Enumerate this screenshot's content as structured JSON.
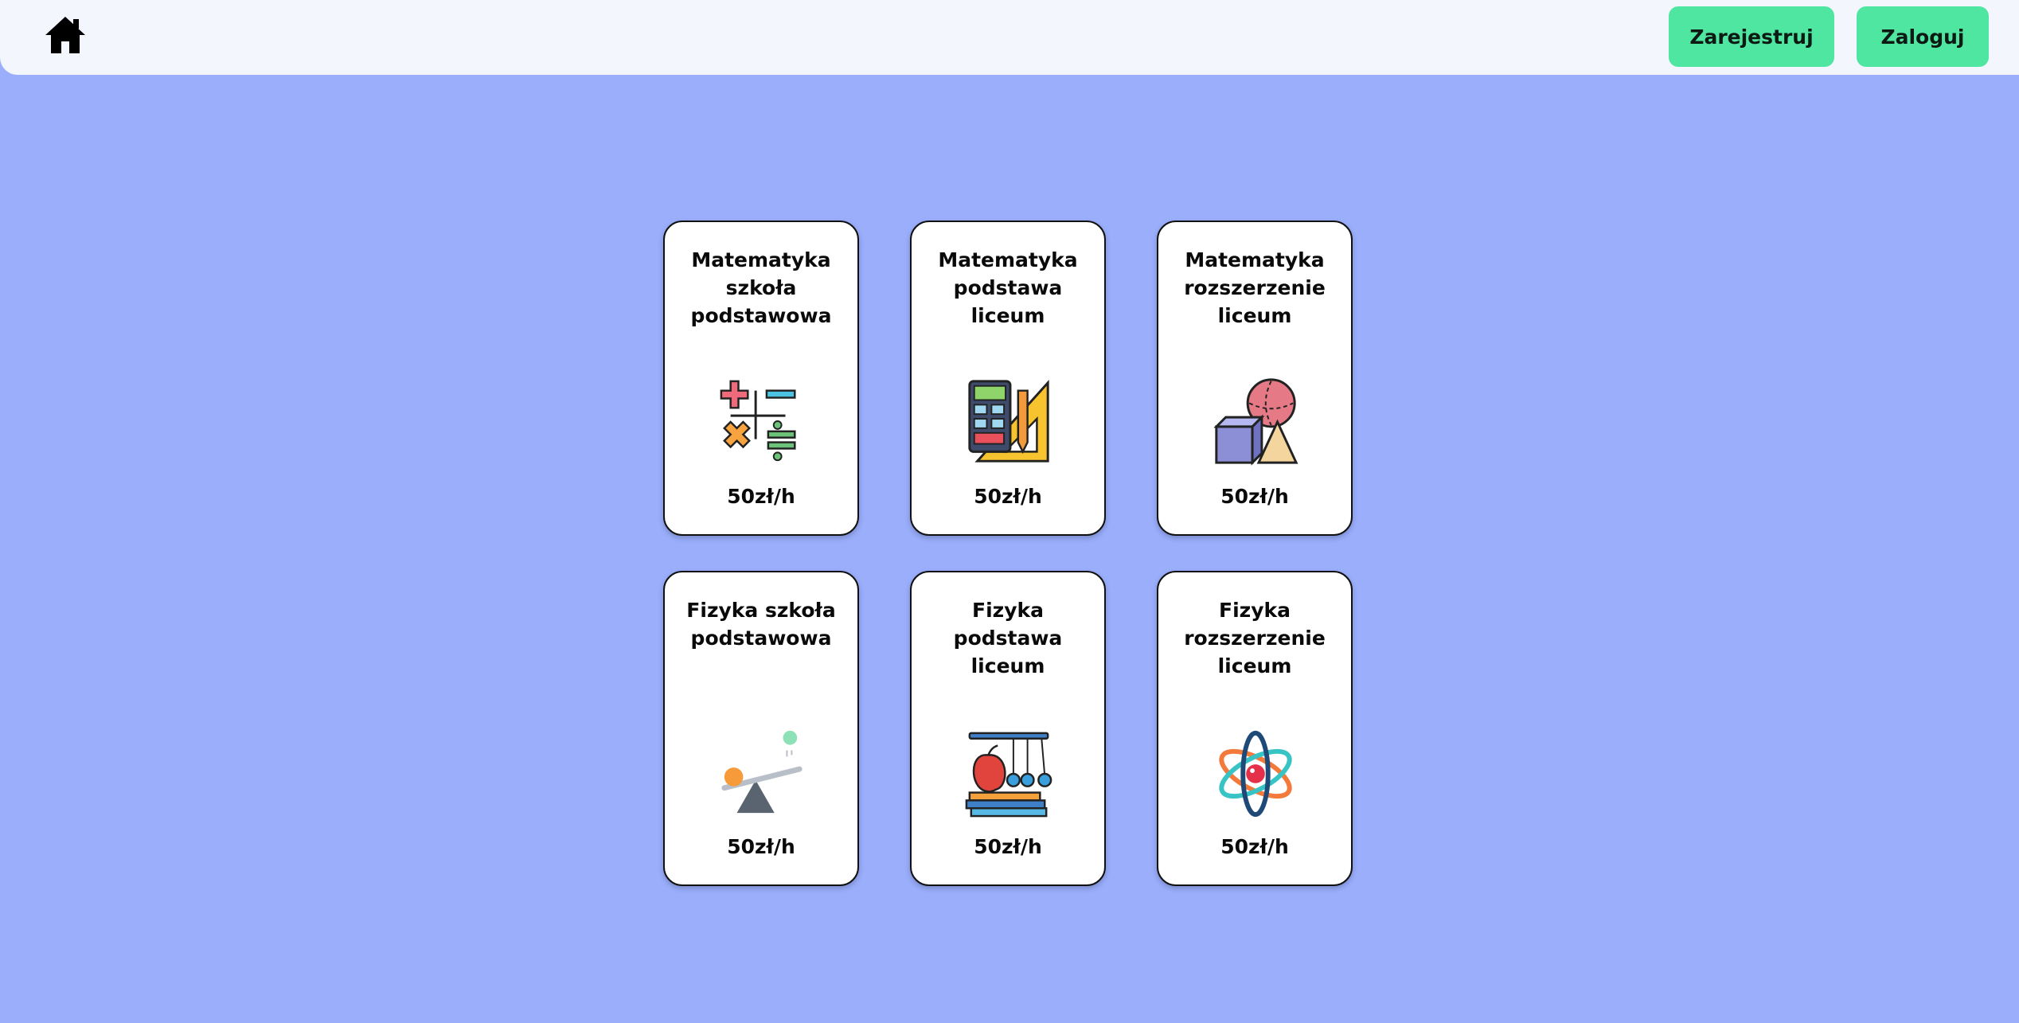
{
  "header": {
    "home_icon": "home-icon",
    "register_label": "Zarejestruj",
    "login_label": "Zaloguj"
  },
  "colors": {
    "background": "#9aaefc",
    "topbar": "#f3f6fd",
    "button": "#4fe6a2",
    "card": "#ffffff"
  },
  "cards": [
    {
      "title": "Matematyka szkoła podstawowa",
      "icon": "math-operators-icon",
      "price": "50zł/h"
    },
    {
      "title": "Matematyka podstawa liceum",
      "icon": "calculator-ruler-icon",
      "price": "50zł/h"
    },
    {
      "title": "Matematyka rozszerzenie liceum",
      "icon": "geometry-shapes-icon",
      "price": "50zł/h"
    },
    {
      "title": "Fizyka szkoła podstawowa",
      "icon": "seesaw-icon",
      "price": "50zł/h"
    },
    {
      "title": "Fizyka podstawa liceum",
      "icon": "newtons-cradle-icon",
      "price": "50zł/h"
    },
    {
      "title": "Fizyka rozszerzenie liceum",
      "icon": "atom-icon",
      "price": "50zł/h"
    }
  ]
}
